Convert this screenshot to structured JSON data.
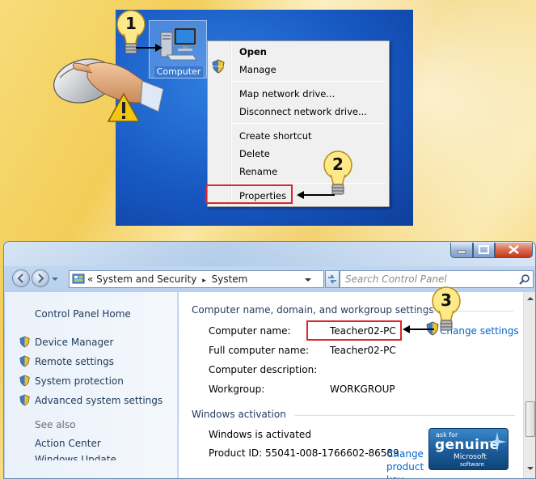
{
  "desktop": {
    "icon_label": "Computer",
    "context_menu": {
      "items": [
        "Open",
        "Manage",
        "Map network drive...",
        "Disconnect network drive...",
        "Create shortcut",
        "Delete",
        "Rename",
        "Properties"
      ]
    }
  },
  "callouts": [
    "1",
    "2",
    "3"
  ],
  "window": {
    "address": {
      "back_glyph": "«",
      "crumbs": [
        "System and Security",
        "System"
      ],
      "separator": "▸"
    },
    "search": {
      "placeholder": "Search Control Panel"
    },
    "sidebar": {
      "home": "Control Panel Home",
      "tasks": [
        "Device Manager",
        "Remote settings",
        "System protection",
        "Advanced system settings"
      ],
      "see_also_title": "See also",
      "see_also": [
        "Action Center",
        "Windows Update"
      ]
    },
    "computer_section": {
      "title": "Computer name, domain, and workgroup settings",
      "rows": [
        {
          "label": "Computer name:",
          "value": "Teacher02-PC"
        },
        {
          "label": "Full computer name:",
          "value": "Teacher02-PC"
        },
        {
          "label": "Computer description:",
          "value": ""
        },
        {
          "label": "Workgroup:",
          "value": "WORKGROUP"
        }
      ],
      "change_settings": "Change settings"
    },
    "activation_section": {
      "title": "Windows activation",
      "status": "Windows is activated",
      "product_id": "Product ID:  55041-008-1766602-86589",
      "change_key_lines": [
        "Change",
        "product",
        "key"
      ]
    },
    "genuine_badge": {
      "ask_for": "ask for",
      "genuine": "genuine",
      "microsoft": "Microsoft",
      "software": "software"
    }
  },
  "colors": {
    "highlight_red": "#d9262b",
    "link_blue": "#0066cc",
    "desktop_blue": "#1757c2"
  }
}
